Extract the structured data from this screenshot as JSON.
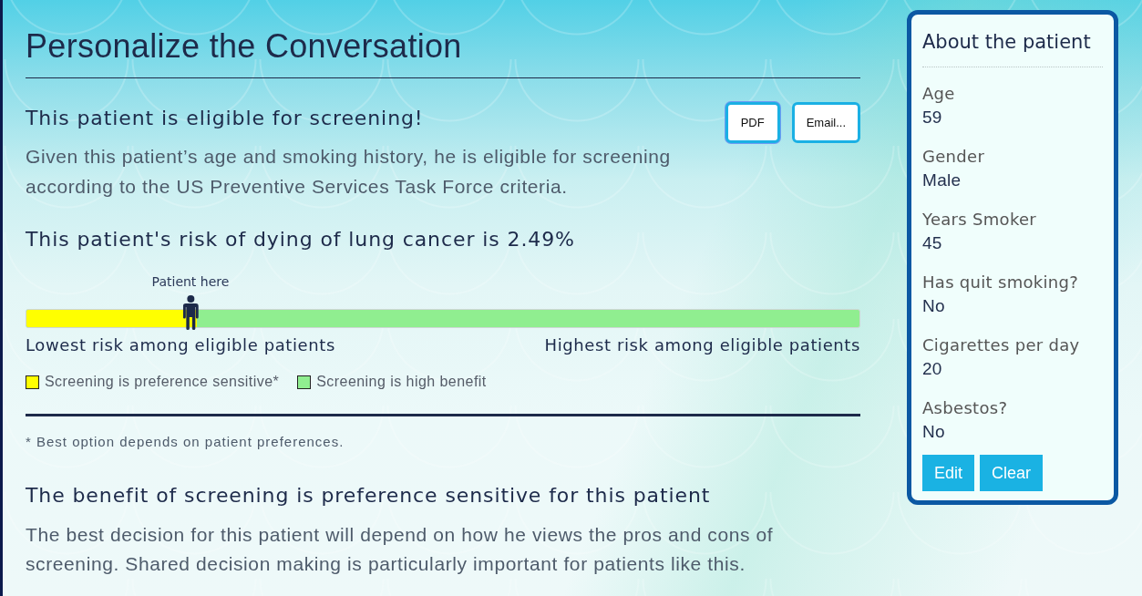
{
  "page": {
    "title": "Personalize the Conversation"
  },
  "eligibility": {
    "heading": "This patient is eligible for screening!",
    "text": "Given this patient’s age and smoking history, he is eligible for screening according to the US Preventive Services Task Force criteria.",
    "buttons": [
      {
        "label": "PDF",
        "focused": true
      },
      {
        "label": "Email...",
        "focused": false
      }
    ]
  },
  "risk": {
    "heading": "This patient's risk of dying of lung cancer is 2.49%",
    "marker_label": "Patient here",
    "level": 0.205,
    "low_label": "Lowest risk among eligible patients",
    "high_label": "Highest risk among eligible patients",
    "legend": [
      {
        "label": "Screening is preference sensitive*",
        "color": "#ffff00"
      },
      {
        "label": "Screening is high benefit",
        "color": "#90ee90"
      }
    ],
    "footnote": "* Best option depends on patient preferences."
  },
  "recommendation": {
    "heading": "The benefit of screening is preference sensitive for this patient",
    "text": "The best decision for this patient will depend on how he views the pros and cons of screening. Shared decision making is particularly important for patients like this."
  },
  "patient_panel": {
    "title": "About the patient",
    "fields": [
      {
        "label": "Age",
        "value": "59"
      },
      {
        "label": "Gender",
        "value": "Male"
      },
      {
        "label": "Years Smoker",
        "value": "45"
      },
      {
        "label": "Has quit smoking?",
        "value": "No"
      },
      {
        "label": "Cigarettes per day",
        "value": "20"
      },
      {
        "label": "Asbestos?",
        "value": "No"
      }
    ],
    "buttons": [
      "Edit",
      "Clear"
    ]
  }
}
